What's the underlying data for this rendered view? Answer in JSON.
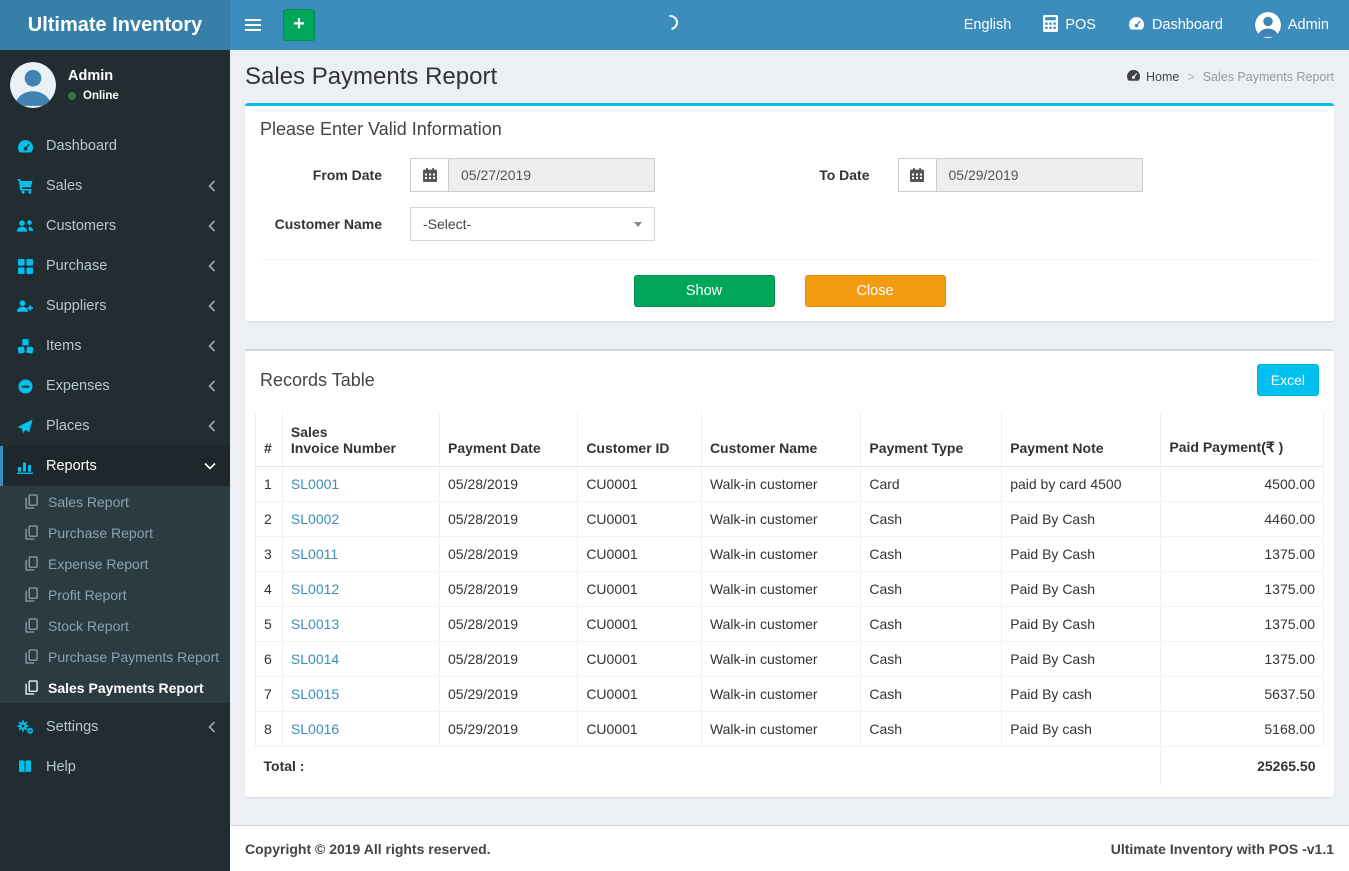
{
  "topbar": {
    "logo": "Ultimate Inventory",
    "plus_label": "+",
    "right": {
      "language": "English",
      "pos": "POS",
      "dashboard": "Dashboard",
      "user": "Admin"
    }
  },
  "sidebar": {
    "user": {
      "name": "Admin",
      "status": "Online"
    },
    "items": [
      {
        "label": "Dashboard",
        "icon": "dashboard-icon"
      },
      {
        "label": "Sales",
        "icon": "cart-icon"
      },
      {
        "label": "Customers",
        "icon": "users-icon"
      },
      {
        "label": "Purchase",
        "icon": "grid-icon"
      },
      {
        "label": "Suppliers",
        "icon": "user-plus-icon"
      },
      {
        "label": "Items",
        "icon": "cubes-icon"
      },
      {
        "label": "Expenses",
        "icon": "minus-circle-icon"
      },
      {
        "label": "Places",
        "icon": "paper-plane-icon"
      },
      {
        "label": "Reports",
        "icon": "bar-chart-icon"
      },
      {
        "label": "Settings",
        "icon": "gears-icon"
      },
      {
        "label": "Help",
        "icon": "book-icon"
      }
    ],
    "reports_submenu": [
      "Sales Report",
      "Purchase Report",
      "Expense Report",
      "Profit Report",
      "Stock Report",
      "Purchase Payments Report",
      "Sales Payments Report"
    ]
  },
  "page": {
    "title": "Sales Payments Report",
    "breadcrumb_home": "Home",
    "breadcrumb_current": "Sales Payments Report"
  },
  "filter": {
    "header": "Please Enter Valid Information",
    "from_date": {
      "label": "From Date",
      "value": "05/27/2019"
    },
    "to_date": {
      "label": "To Date",
      "value": "05/29/2019"
    },
    "customer": {
      "label": "Customer Name",
      "value": "-Select-"
    },
    "show_label": "Show",
    "close_label": "Close"
  },
  "records": {
    "title": "Records Table",
    "excel_label": "Excel",
    "headers": [
      "#",
      "Sales\nInvoice Number",
      "Payment Date",
      "Customer ID",
      "Customer Name",
      "Payment Type",
      "Payment Note",
      "Paid Payment(₹ )"
    ],
    "rows": [
      [
        "1",
        "SL0001",
        "05/28/2019",
        "CU0001",
        "Walk-in customer",
        "Card",
        "paid by card 4500",
        "4500.00"
      ],
      [
        "2",
        "SL0002",
        "05/28/2019",
        "CU0001",
        "Walk-in customer",
        "Cash",
        "Paid By Cash",
        "4460.00"
      ],
      [
        "3",
        "SL0011",
        "05/28/2019",
        "CU0001",
        "Walk-in customer",
        "Cash",
        "Paid By Cash",
        "1375.00"
      ],
      [
        "4",
        "SL0012",
        "05/28/2019",
        "CU0001",
        "Walk-in customer",
        "Cash",
        "Paid By Cash",
        "1375.00"
      ],
      [
        "5",
        "SL0013",
        "05/28/2019",
        "CU0001",
        "Walk-in customer",
        "Cash",
        "Paid By Cash",
        "1375.00"
      ],
      [
        "6",
        "SL0014",
        "05/28/2019",
        "CU0001",
        "Walk-in customer",
        "Cash",
        "Paid By Cash",
        "1375.00"
      ],
      [
        "7",
        "SL0015",
        "05/29/2019",
        "CU0001",
        "Walk-in customer",
        "Cash",
        "Paid By cash",
        "5637.50"
      ],
      [
        "8",
        "SL0016",
        "05/29/2019",
        "CU0001",
        "Walk-in customer",
        "Cash",
        "Paid By cash",
        "5168.00"
      ]
    ],
    "total_label": "Total :",
    "total_value": "25265.50"
  },
  "footer": {
    "left": "Copyright © 2019 All rights reserved.",
    "right": "Ultimate Inventory with POS -v1.1"
  },
  "colors": {
    "navbar": "#3c8dbc",
    "logo_bg": "#367fa9",
    "sidebar_bg": "#222d32",
    "accent_cyan": "#00c0ef",
    "green": "#00a65a",
    "orange": "#f39c12",
    "link": "#3c8dbc",
    "online_dot": "#3c763d"
  }
}
